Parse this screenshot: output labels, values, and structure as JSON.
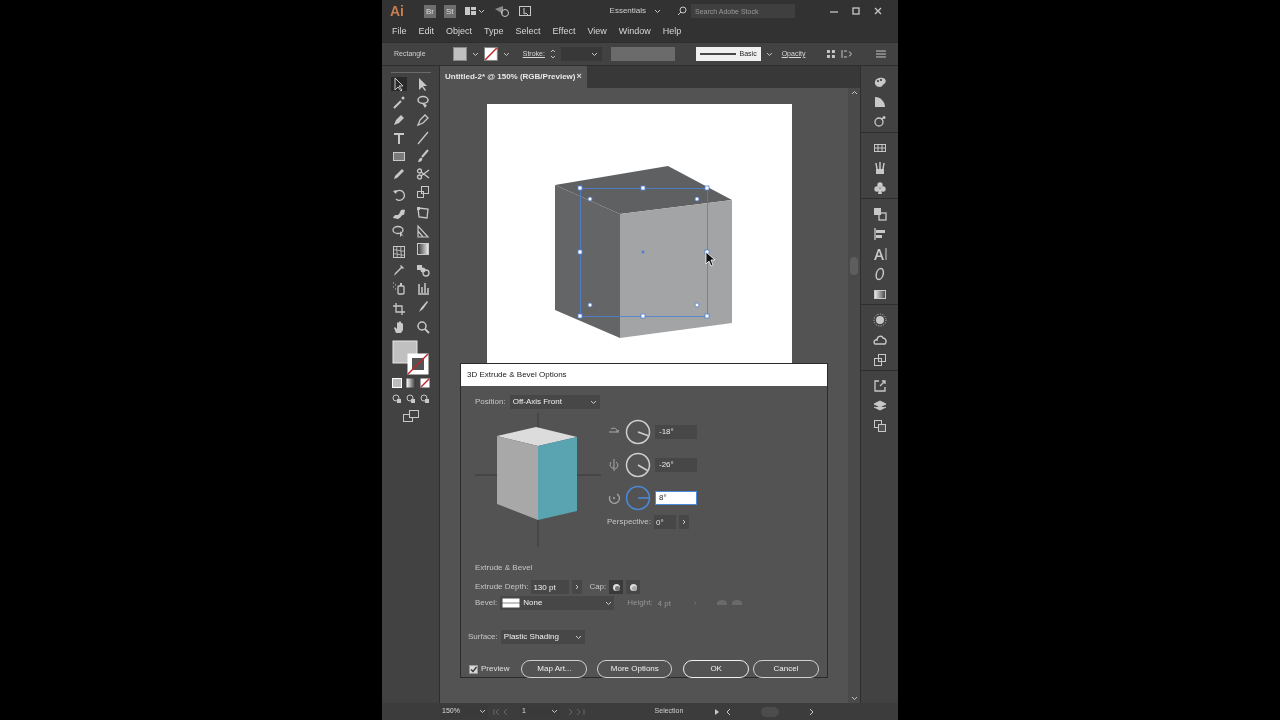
{
  "title_bar": {
    "logo": "Ai",
    "bridge": "Br",
    "stock": "St",
    "workspace": "Essentials",
    "search": {
      "placeholder": "Search Adobe Stock"
    }
  },
  "menu": [
    "File",
    "Edit",
    "Object",
    "Type",
    "Select",
    "Effect",
    "View",
    "Window",
    "Help"
  ],
  "control_bar": {
    "tool": "Rectangle",
    "stroke_label": "Stroke:",
    "brush": "Basic",
    "opacity_label": "Opacity"
  },
  "document_tab": {
    "title": "Untitled-2* @ 150% (RGB/Preview)",
    "close": "×"
  },
  "dialog": {
    "title": "3D Extrude & Bevel Options",
    "position": {
      "label": "Position:",
      "value": "Off-Axis Front"
    },
    "rotations": [
      {
        "value": "-18°",
        "focused": false
      },
      {
        "value": "-26°",
        "focused": false
      },
      {
        "value": "8°",
        "focused": true
      }
    ],
    "perspective": {
      "label": "Perspective:",
      "value": "0°"
    },
    "section": "Extrude & Bevel",
    "extrude_depth": {
      "label": "Extrude Depth:",
      "value": "130 pt"
    },
    "cap": {
      "label": "Cap:"
    },
    "bevel": {
      "label": "Bevel:",
      "value": "None"
    },
    "height": {
      "label": "Height:",
      "value": "4 pt",
      "disabled": true
    },
    "surface": {
      "label": "Surface:",
      "value": "Plastic Shading"
    },
    "preview": {
      "label": "Preview",
      "checked": true
    },
    "buttons": [
      {
        "label": "Map Art...",
        "default": false
      },
      {
        "label": "More Options",
        "default": false
      },
      {
        "label": "OK",
        "default": true
      },
      {
        "label": "Cancel",
        "default": false
      }
    ]
  },
  "status_bar": {
    "zoom": "150%",
    "artboard": "1",
    "tool": "Selection"
  }
}
